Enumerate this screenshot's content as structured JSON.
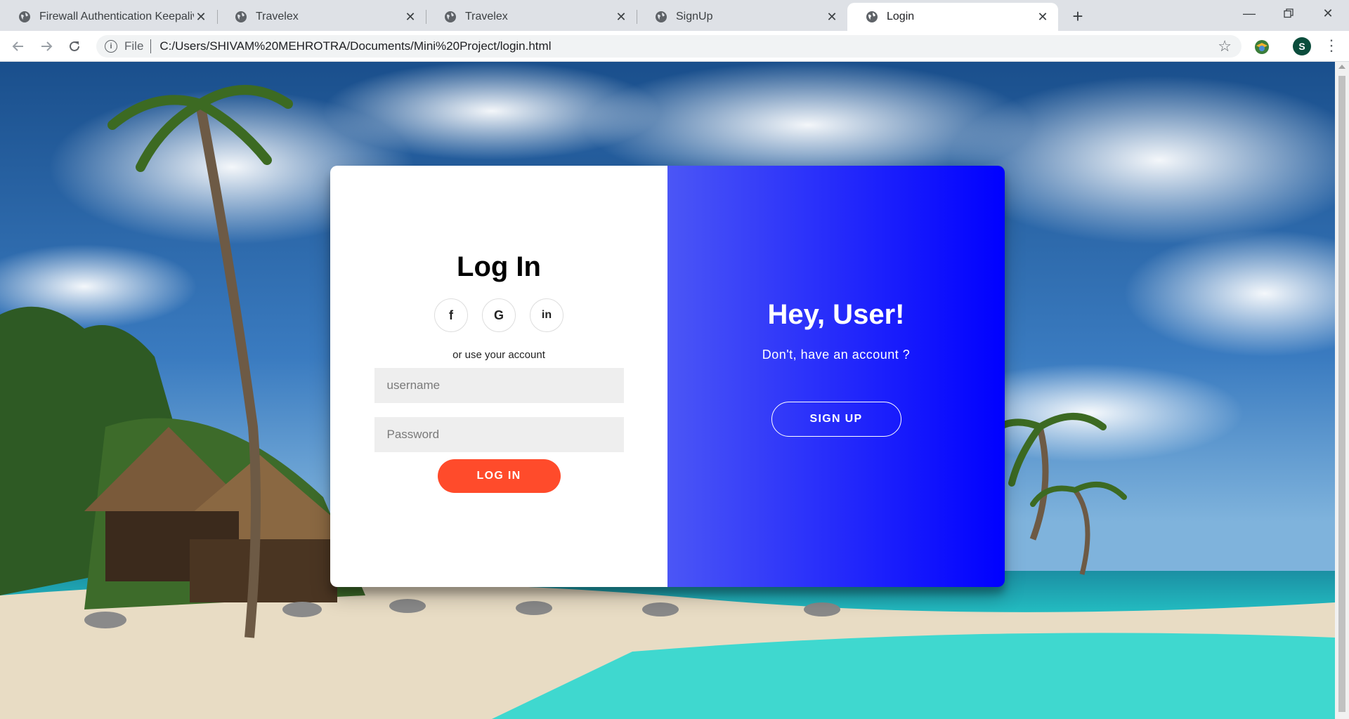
{
  "browser": {
    "tabs": [
      {
        "title": "Firewall Authentication Keepalive",
        "active": false
      },
      {
        "title": "Travelex",
        "active": false
      },
      {
        "title": "Travelex",
        "active": false
      },
      {
        "title": "SignUp",
        "active": false
      },
      {
        "title": "Login",
        "active": true
      }
    ],
    "new_tab_label": "+",
    "address": {
      "scheme_label": "File",
      "url": "C:/Users/SHIVAM%20MEHROTRA/Documents/Mini%20Project/login.html"
    },
    "profile_initial": "S",
    "icons": {
      "back": "back-arrow-icon",
      "forward": "forward-arrow-icon",
      "reload": "reload-icon",
      "info": "info-icon",
      "bookmark": "star-icon",
      "menu": "kebab-menu-icon"
    }
  },
  "login": {
    "title": "Log In",
    "social": [
      {
        "name": "facebook",
        "glyph": "f"
      },
      {
        "name": "google",
        "glyph": "G"
      },
      {
        "name": "linkedin",
        "glyph": "in"
      }
    ],
    "alt_text": "or use your account",
    "username_placeholder": "username",
    "password_placeholder": "Password",
    "submit_label": "LOG IN"
  },
  "overlay": {
    "heading": "Hey, User!",
    "message": "Don't, have an account ?",
    "signup_label": "SIGN UP"
  },
  "colors": {
    "accent_button": "#ff4b2b",
    "panel_gradient_start": "#4b56f6",
    "panel_gradient_end": "#0000ff"
  }
}
